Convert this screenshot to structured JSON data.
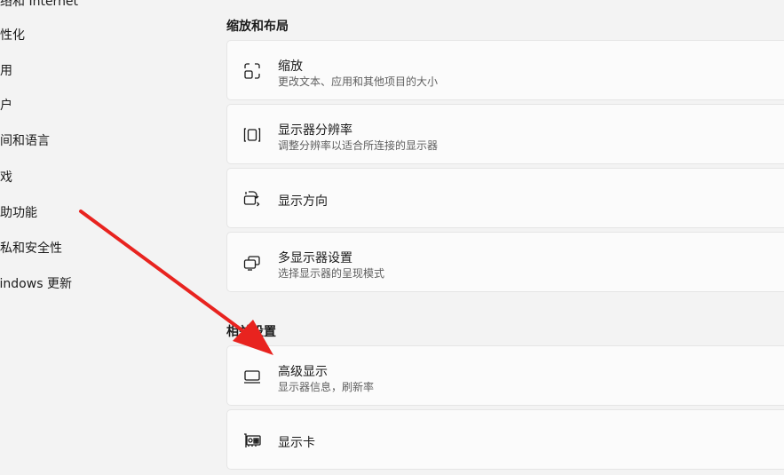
{
  "sidebar": {
    "items": [
      {
        "label": "网络和 Internet"
      },
      {
        "label": "个性化"
      },
      {
        "label": "应用"
      },
      {
        "label": "帐户"
      },
      {
        "label": "时间和语言"
      },
      {
        "label": "游戏"
      },
      {
        "label": "辅助功能"
      },
      {
        "label": "隐私和安全性"
      },
      {
        "label": "Windows 更新"
      }
    ]
  },
  "main": {
    "scale_layout": {
      "heading": "缩放和布局",
      "cards": [
        {
          "title": "缩放",
          "subtitle": "更改文本、应用和其他项目的大小",
          "icon": "zoom-icon"
        },
        {
          "title": "显示器分辨率",
          "subtitle": "调整分辨率以适合所连接的显示器",
          "icon": "resolution-icon"
        },
        {
          "title": "显示方向",
          "subtitle": "",
          "icon": "orientation-icon"
        },
        {
          "title": "多显示器设置",
          "subtitle": "选择显示器的呈现模式",
          "icon": "multi-display-icon"
        }
      ]
    },
    "related": {
      "heading": "相关设置",
      "cards": [
        {
          "title": "高级显示",
          "subtitle": "显示器信息，刷新率",
          "icon": "monitor-icon"
        },
        {
          "title": "显示卡",
          "subtitle": "",
          "icon": "graphics-card-icon"
        }
      ]
    }
  },
  "annotation": {
    "arrow_color": "#e8231f"
  }
}
